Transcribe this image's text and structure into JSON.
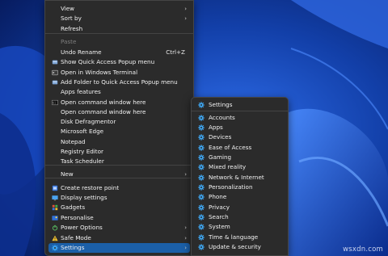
{
  "main_menu": {
    "items": [
      {
        "label": "View",
        "arrow": true,
        "icon": ""
      },
      {
        "label": "Sort by",
        "arrow": true,
        "icon": ""
      },
      {
        "label": "Refresh",
        "icon": ""
      },
      {
        "label": "Paste",
        "disabled": true,
        "icon": ""
      },
      {
        "label": "Undo Rename",
        "shortcut": "Ctrl+Z",
        "icon": ""
      },
      {
        "label": "Show Quick Access Popup menu",
        "icon": "quick-access-icon"
      },
      {
        "label": "Open in Windows Terminal",
        "icon": "terminal-icon"
      },
      {
        "label": "Add Folder to Quick Access Popup menu",
        "icon": "quick-access-icon"
      },
      {
        "label": "Apps  features",
        "icon": ""
      },
      {
        "label": "Open command window here",
        "icon": "cmd-icon"
      },
      {
        "label": "Open command window here",
        "icon": ""
      },
      {
        "label": "Disk Defragmentor",
        "icon": ""
      },
      {
        "label": "Microsoft Edge",
        "icon": ""
      },
      {
        "label": "Notepad",
        "icon": ""
      },
      {
        "label": "Registry Editor",
        "icon": ""
      },
      {
        "label": "Task Scheduler",
        "icon": ""
      },
      {
        "label": "New",
        "arrow": true,
        "icon": ""
      },
      {
        "label": "Create restore point",
        "icon": "restore-icon"
      },
      {
        "label": "Display settings",
        "icon": "display-icon"
      },
      {
        "label": "Gadgets",
        "icon": "gadgets-icon"
      },
      {
        "label": "Personalise",
        "icon": "personalise-icon"
      },
      {
        "label": "Power Options",
        "arrow": true,
        "icon": "power-icon"
      },
      {
        "label": "Safe Mode",
        "arrow": true,
        "icon": "warning-icon"
      },
      {
        "label": "Settings",
        "arrow": true,
        "icon": "gear-icon",
        "highlighted": true
      }
    ]
  },
  "settings_submenu": {
    "items": [
      {
        "label": "Settings"
      },
      {
        "label": "Accounts"
      },
      {
        "label": "Apps"
      },
      {
        "label": "Devices"
      },
      {
        "label": "Ease of Access"
      },
      {
        "label": "Gaming"
      },
      {
        "label": "Mixed reality"
      },
      {
        "label": "Network & Internet"
      },
      {
        "label": "Personalization"
      },
      {
        "label": "Phone"
      },
      {
        "label": "Privacy"
      },
      {
        "label": "Search"
      },
      {
        "label": "System"
      },
      {
        "label": "Time & language"
      },
      {
        "label": "Update & security"
      }
    ],
    "icon": "gear-icon"
  },
  "watermark": "wsxdn.com",
  "colors": {
    "accent": "#1b5fa8",
    "menu_bg": "#2b2b2b",
    "gear": "#3fa9f5"
  }
}
